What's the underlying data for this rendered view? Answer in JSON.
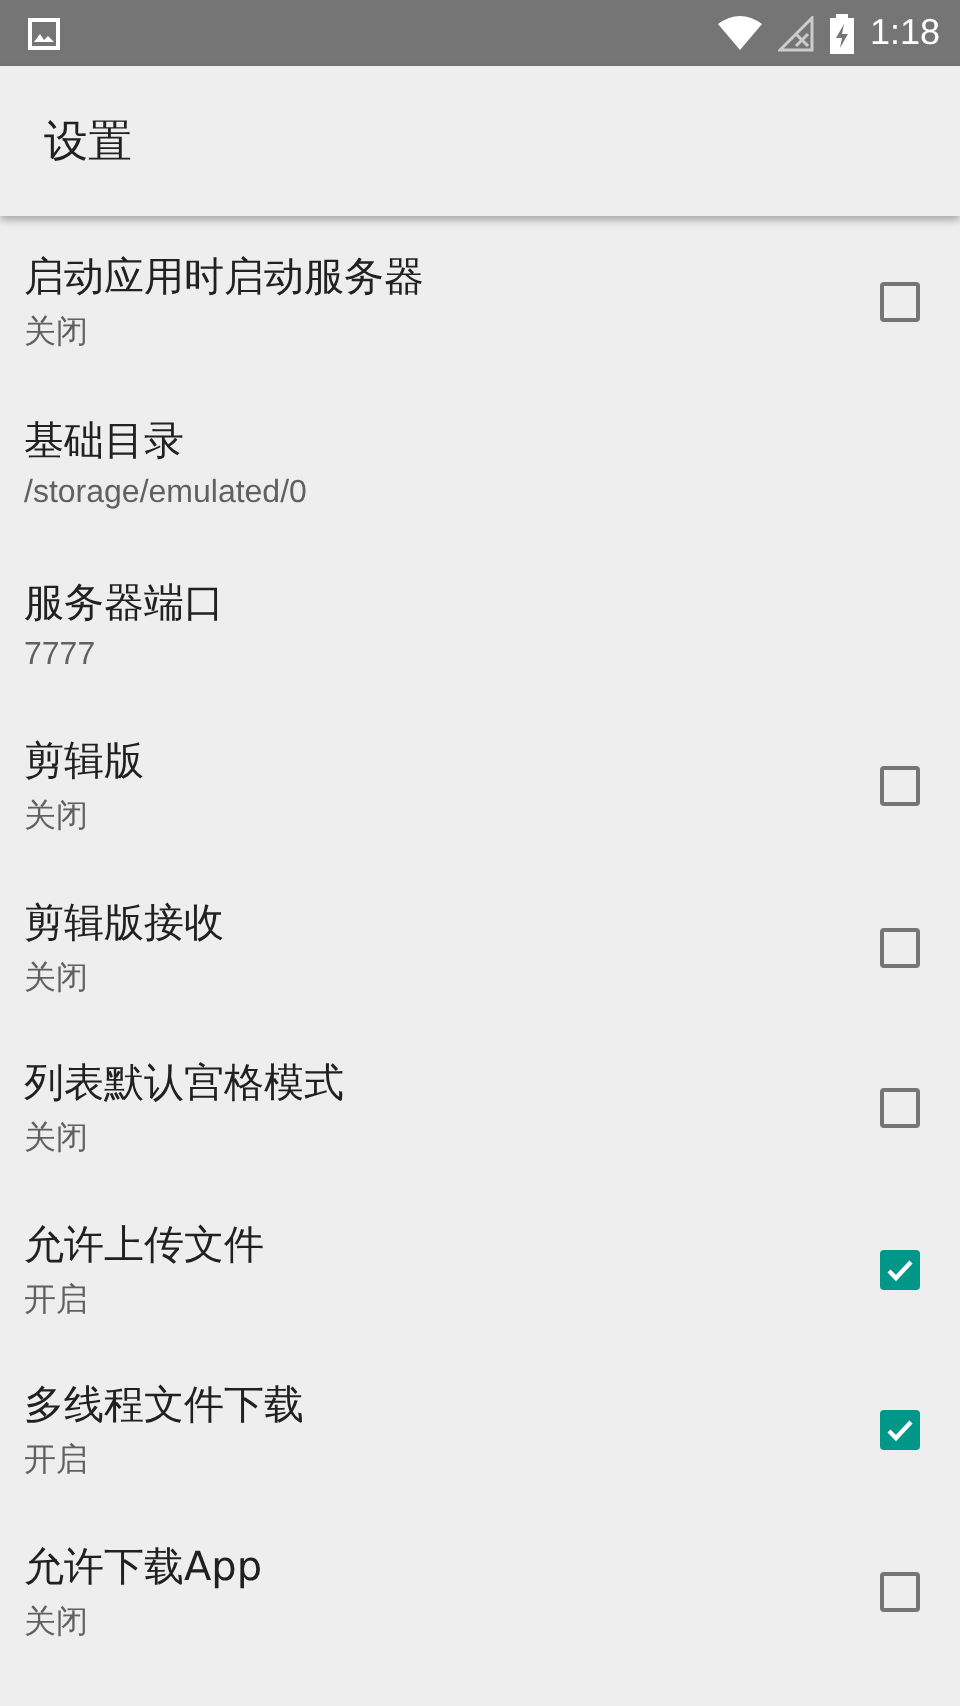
{
  "status_bar": {
    "time": "1:18"
  },
  "app_bar": {
    "title": "设置"
  },
  "settings": [
    {
      "kind": "checkbox",
      "title": "启动应用时启动服务器",
      "summary": "关闭",
      "checked": false
    },
    {
      "kind": "text",
      "title": "基础目录",
      "summary": "/storage/emulated/0"
    },
    {
      "kind": "text",
      "title": "服务器端口",
      "summary": "7777"
    },
    {
      "kind": "checkbox",
      "title": "剪辑版",
      "summary": "关闭",
      "checked": false
    },
    {
      "kind": "checkbox",
      "title": "剪辑版接收",
      "summary": "关闭",
      "checked": false
    },
    {
      "kind": "checkbox",
      "title": "列表默认宫格模式",
      "summary": "关闭",
      "checked": false
    },
    {
      "kind": "checkbox",
      "title": "允许上传文件",
      "summary": "开启",
      "checked": true
    },
    {
      "kind": "checkbox",
      "title": "多线程文件下载",
      "summary": "开启",
      "checked": true
    },
    {
      "kind": "checkbox",
      "title": "允许下载App",
      "summary": "关闭",
      "checked": false
    }
  ]
}
